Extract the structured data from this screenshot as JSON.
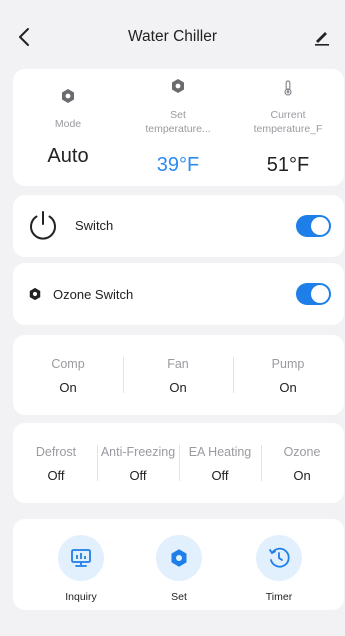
{
  "header": {
    "title": "Water Chiller",
    "back_icon": "chevron-left-icon",
    "edit_icon": "edit-pencil-icon"
  },
  "overview": {
    "mode": {
      "label": "Mode",
      "value": "Auto",
      "icon": "hexagon-gear-icon"
    },
    "set_temp": {
      "label_line1": "Set",
      "label_line2": "temperature...",
      "value": "39°F",
      "icon": "hexagon-gear-icon",
      "value_color": "#2d8cf0"
    },
    "current_temp": {
      "label_line1": "Current",
      "label_line2": "temperature_F",
      "value": "51°F",
      "icon": "thermometer-icon"
    }
  },
  "switches": [
    {
      "label": "Switch",
      "icon": "power-icon",
      "on": true
    },
    {
      "label": "Ozone Switch",
      "icon": "hexagon-gear-icon",
      "on": true
    }
  ],
  "status_row_1": [
    {
      "label": "Comp",
      "value": "On"
    },
    {
      "label": "Fan",
      "value": "On"
    },
    {
      "label": "Pump",
      "value": "On"
    }
  ],
  "status_row_2": [
    {
      "label": "Defrost",
      "value": "Off"
    },
    {
      "label": "Anti-Freezing",
      "value": "Off"
    },
    {
      "label": "EA Heating",
      "value": "Off"
    },
    {
      "label": "Ozone",
      "value": "On"
    }
  ],
  "actions": [
    {
      "label": "Inquiry",
      "icon": "monitor-chart-icon"
    },
    {
      "label": "Set",
      "icon": "hexagon-gear-icon"
    },
    {
      "label": "Timer",
      "icon": "clock-timer-icon"
    }
  ],
  "colors": {
    "accent": "#1e7fe8",
    "background": "#f2f2f4",
    "action_circle": "#e2effc"
  }
}
